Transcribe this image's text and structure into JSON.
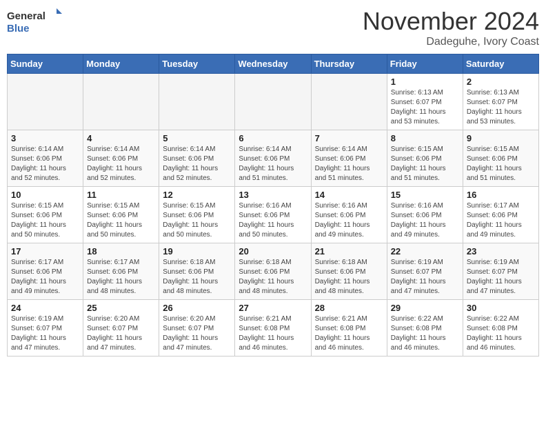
{
  "header": {
    "logo_general": "General",
    "logo_blue": "Blue",
    "month_title": "November 2024",
    "location": "Dadeguhe, Ivory Coast"
  },
  "weekdays": [
    "Sunday",
    "Monday",
    "Tuesday",
    "Wednesday",
    "Thursday",
    "Friday",
    "Saturday"
  ],
  "weeks": [
    [
      {
        "day": "",
        "info": ""
      },
      {
        "day": "",
        "info": ""
      },
      {
        "day": "",
        "info": ""
      },
      {
        "day": "",
        "info": ""
      },
      {
        "day": "",
        "info": ""
      },
      {
        "day": "1",
        "info": "Sunrise: 6:13 AM\nSunset: 6:07 PM\nDaylight: 11 hours and 53 minutes."
      },
      {
        "day": "2",
        "info": "Sunrise: 6:13 AM\nSunset: 6:07 PM\nDaylight: 11 hours and 53 minutes."
      }
    ],
    [
      {
        "day": "3",
        "info": "Sunrise: 6:14 AM\nSunset: 6:06 PM\nDaylight: 11 hours and 52 minutes."
      },
      {
        "day": "4",
        "info": "Sunrise: 6:14 AM\nSunset: 6:06 PM\nDaylight: 11 hours and 52 minutes."
      },
      {
        "day": "5",
        "info": "Sunrise: 6:14 AM\nSunset: 6:06 PM\nDaylight: 11 hours and 52 minutes."
      },
      {
        "day": "6",
        "info": "Sunrise: 6:14 AM\nSunset: 6:06 PM\nDaylight: 11 hours and 51 minutes."
      },
      {
        "day": "7",
        "info": "Sunrise: 6:14 AM\nSunset: 6:06 PM\nDaylight: 11 hours and 51 minutes."
      },
      {
        "day": "8",
        "info": "Sunrise: 6:15 AM\nSunset: 6:06 PM\nDaylight: 11 hours and 51 minutes."
      },
      {
        "day": "9",
        "info": "Sunrise: 6:15 AM\nSunset: 6:06 PM\nDaylight: 11 hours and 51 minutes."
      }
    ],
    [
      {
        "day": "10",
        "info": "Sunrise: 6:15 AM\nSunset: 6:06 PM\nDaylight: 11 hours and 50 minutes."
      },
      {
        "day": "11",
        "info": "Sunrise: 6:15 AM\nSunset: 6:06 PM\nDaylight: 11 hours and 50 minutes."
      },
      {
        "day": "12",
        "info": "Sunrise: 6:15 AM\nSunset: 6:06 PM\nDaylight: 11 hours and 50 minutes."
      },
      {
        "day": "13",
        "info": "Sunrise: 6:16 AM\nSunset: 6:06 PM\nDaylight: 11 hours and 50 minutes."
      },
      {
        "day": "14",
        "info": "Sunrise: 6:16 AM\nSunset: 6:06 PM\nDaylight: 11 hours and 49 minutes."
      },
      {
        "day": "15",
        "info": "Sunrise: 6:16 AM\nSunset: 6:06 PM\nDaylight: 11 hours and 49 minutes."
      },
      {
        "day": "16",
        "info": "Sunrise: 6:17 AM\nSunset: 6:06 PM\nDaylight: 11 hours and 49 minutes."
      }
    ],
    [
      {
        "day": "17",
        "info": "Sunrise: 6:17 AM\nSunset: 6:06 PM\nDaylight: 11 hours and 49 minutes."
      },
      {
        "day": "18",
        "info": "Sunrise: 6:17 AM\nSunset: 6:06 PM\nDaylight: 11 hours and 48 minutes."
      },
      {
        "day": "19",
        "info": "Sunrise: 6:18 AM\nSunset: 6:06 PM\nDaylight: 11 hours and 48 minutes."
      },
      {
        "day": "20",
        "info": "Sunrise: 6:18 AM\nSunset: 6:06 PM\nDaylight: 11 hours and 48 minutes."
      },
      {
        "day": "21",
        "info": "Sunrise: 6:18 AM\nSunset: 6:06 PM\nDaylight: 11 hours and 48 minutes."
      },
      {
        "day": "22",
        "info": "Sunrise: 6:19 AM\nSunset: 6:07 PM\nDaylight: 11 hours and 47 minutes."
      },
      {
        "day": "23",
        "info": "Sunrise: 6:19 AM\nSunset: 6:07 PM\nDaylight: 11 hours and 47 minutes."
      }
    ],
    [
      {
        "day": "24",
        "info": "Sunrise: 6:19 AM\nSunset: 6:07 PM\nDaylight: 11 hours and 47 minutes."
      },
      {
        "day": "25",
        "info": "Sunrise: 6:20 AM\nSunset: 6:07 PM\nDaylight: 11 hours and 47 minutes."
      },
      {
        "day": "26",
        "info": "Sunrise: 6:20 AM\nSunset: 6:07 PM\nDaylight: 11 hours and 47 minutes."
      },
      {
        "day": "27",
        "info": "Sunrise: 6:21 AM\nSunset: 6:08 PM\nDaylight: 11 hours and 46 minutes."
      },
      {
        "day": "28",
        "info": "Sunrise: 6:21 AM\nSunset: 6:08 PM\nDaylight: 11 hours and 46 minutes."
      },
      {
        "day": "29",
        "info": "Sunrise: 6:22 AM\nSunset: 6:08 PM\nDaylight: 11 hours and 46 minutes."
      },
      {
        "day": "30",
        "info": "Sunrise: 6:22 AM\nSunset: 6:08 PM\nDaylight: 11 hours and 46 minutes."
      }
    ]
  ]
}
